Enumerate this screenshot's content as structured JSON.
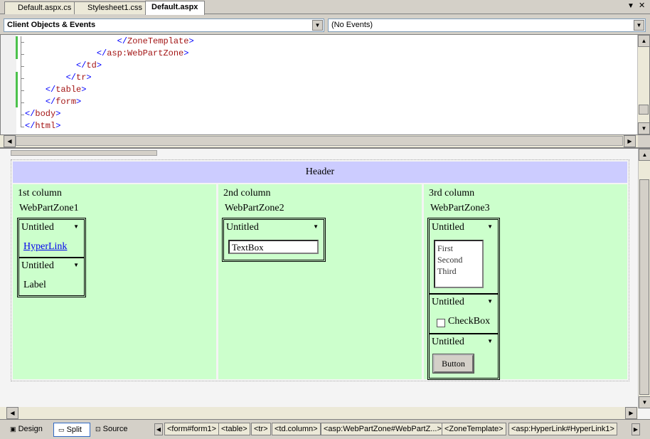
{
  "tabs": [
    {
      "label": "Default.aspx.cs"
    },
    {
      "label": "Stylesheet1.css"
    },
    {
      "label": "Default.aspx"
    }
  ],
  "dropdowns": {
    "left": "Client Objects & Events",
    "right": "(No Events)"
  },
  "code_lines": [
    {
      "indent": "                  ",
      "open": "</",
      "tag": "ZoneTemplate",
      "close": ">"
    },
    {
      "indent": "              ",
      "open": "</",
      "tag": "asp:WebPartZone",
      "close": ">"
    },
    {
      "indent": "          ",
      "open": "</",
      "tag": "td",
      "close": ">"
    },
    {
      "indent": "        ",
      "open": "</",
      "tag": "tr",
      "close": ">"
    },
    {
      "indent": "    ",
      "open": "</",
      "tag": "table",
      "close": ">"
    },
    {
      "indent": "    ",
      "open": "</",
      "tag": "form",
      "close": ">"
    },
    {
      "indent": "",
      "open": "</",
      "tag": "body",
      "close": ">"
    },
    {
      "indent": "",
      "open": "</",
      "tag": "html",
      "close": ">"
    }
  ],
  "design": {
    "header": "Header",
    "columns": [
      {
        "title": "1st column",
        "zone": "WebPartZone1",
        "parts": [
          {
            "title": "Untitled",
            "content": "HyperLink"
          },
          {
            "title": "Untitled",
            "content": "Label"
          }
        ]
      },
      {
        "title": "2nd column",
        "zone": "WebPartZone2",
        "parts": [
          {
            "title": "Untitled",
            "content": "TextBox"
          }
        ]
      },
      {
        "title": "3rd column",
        "zone": "WebPartZone3",
        "parts": [
          {
            "title": "Untitled",
            "list": [
              "First",
              "Second",
              "Third"
            ]
          },
          {
            "title": "Untitled",
            "content": "CheckBox"
          },
          {
            "title": "Untitled",
            "content": "Button"
          }
        ]
      }
    ]
  },
  "views": [
    {
      "label": "Design"
    },
    {
      "label": "Split"
    },
    {
      "label": "Source"
    }
  ],
  "breadcrumbs": [
    "<form#form1>",
    "<table>",
    "<tr>",
    "<td.column>",
    "<asp:WebPartZone#WebPartZ...>",
    "<ZoneTemplate>",
    "<asp:HyperLink#HyperLink1>"
  ]
}
